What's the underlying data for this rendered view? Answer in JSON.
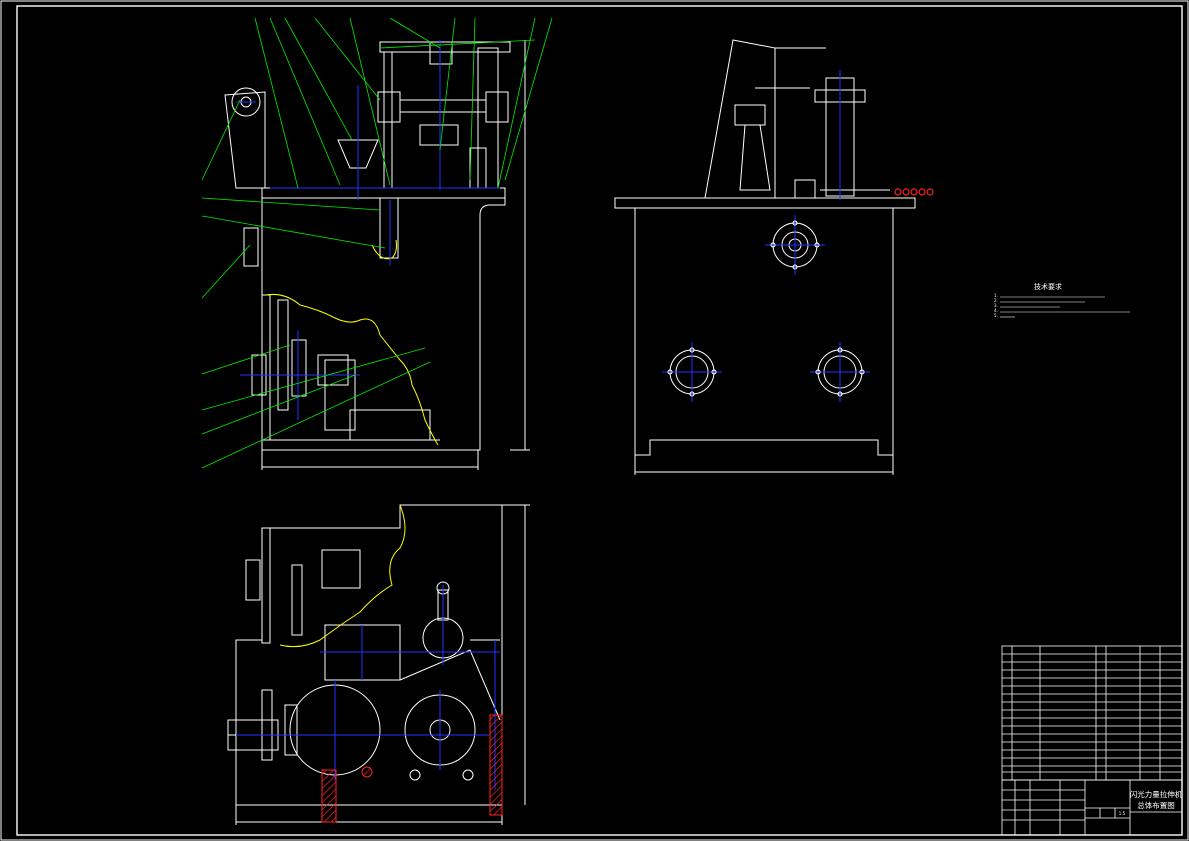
{
  "drawing": {
    "views": [
      "front-view",
      "side-view",
      "top-view"
    ],
    "colors": {
      "background": "#000000",
      "outline": "#ffffff",
      "center_line": "#0000ff",
      "leader": "#00ff00",
      "break_line": "#ffff00",
      "hatch": "#ff0000"
    }
  },
  "technical_notes": {
    "title": "技术要求",
    "lines": [
      "1.",
      "2.",
      "3.",
      "4.",
      "5."
    ]
  },
  "title_block": {
    "product_name": "闪光力量拉伸机",
    "drawing_name": "总体布置图",
    "scale": "1:5"
  }
}
